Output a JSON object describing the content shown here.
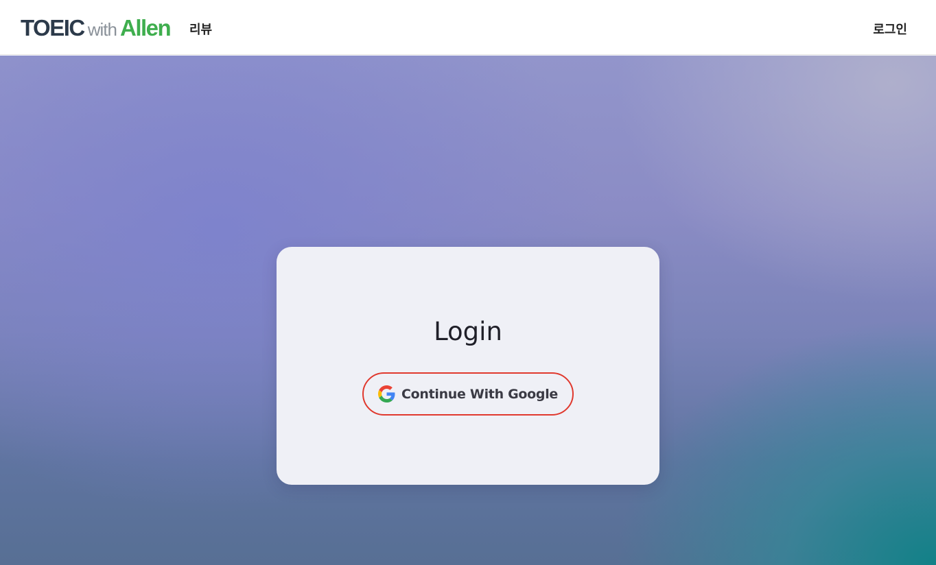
{
  "header": {
    "logo": {
      "part1": "TOEIC",
      "part2": "with",
      "part3": "Allen"
    },
    "nav": {
      "review_label": "리뷰",
      "login_label": "로그인"
    }
  },
  "login_card": {
    "title": "Login",
    "google_button_label": "Continue With Google",
    "google_button_icon": "google-icon",
    "button_border_color": "#e0382d"
  },
  "colors": {
    "logo_dark": "#2c3a4a",
    "logo_gray": "#8a9199",
    "logo_green": "#3fae4e"
  }
}
